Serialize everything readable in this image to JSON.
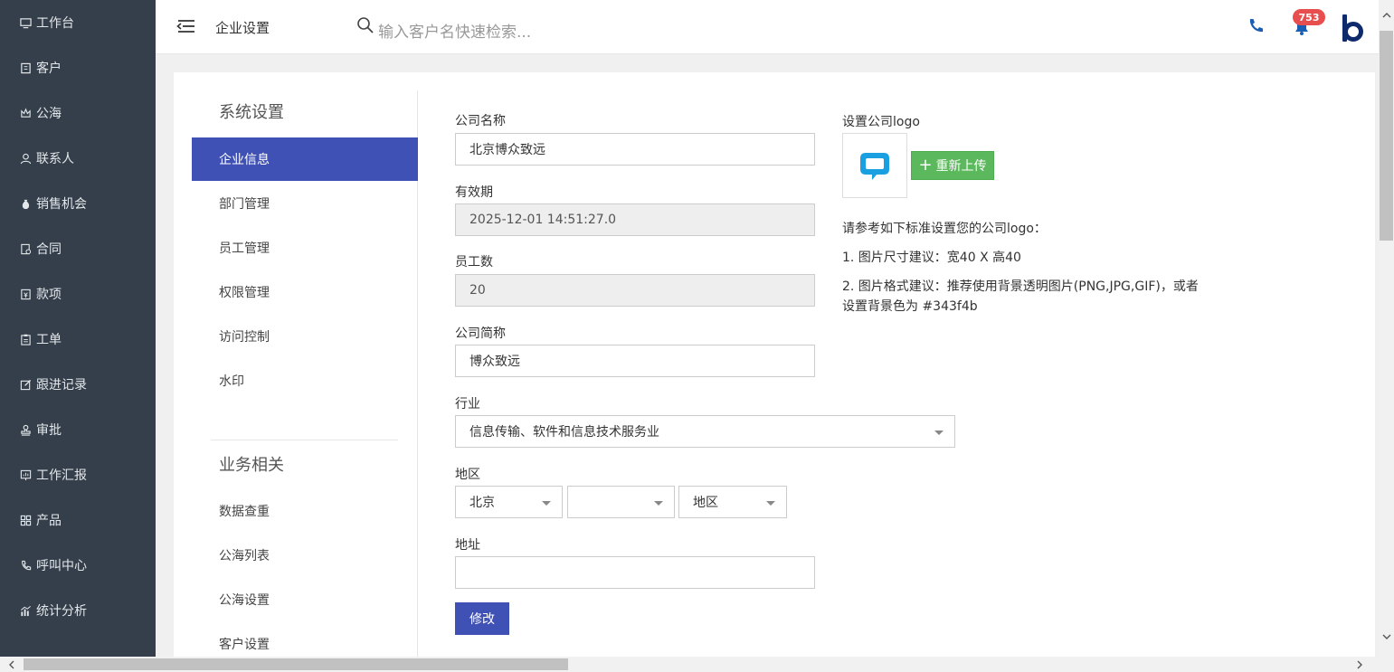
{
  "nav": {
    "items": [
      {
        "label": "工作台",
        "icon": "monitor-icon"
      },
      {
        "label": "客户",
        "icon": "building-icon"
      },
      {
        "label": "公海",
        "icon": "crown-icon"
      },
      {
        "label": "联系人",
        "icon": "user-icon"
      },
      {
        "label": "销售机会",
        "icon": "money-bag-icon"
      },
      {
        "label": "合同",
        "icon": "contract-icon"
      },
      {
        "label": "款项",
        "icon": "payment-icon"
      },
      {
        "label": "工单",
        "icon": "clipboard-icon"
      },
      {
        "label": "跟进记录",
        "icon": "edit-icon"
      },
      {
        "label": "审批",
        "icon": "stamp-icon"
      },
      {
        "label": "工作汇报",
        "icon": "report-icon"
      },
      {
        "label": "产品",
        "icon": "grid-icon"
      },
      {
        "label": "呼叫中心",
        "icon": "phone-call-icon"
      },
      {
        "label": "统计分析",
        "icon": "chart-icon"
      }
    ]
  },
  "header": {
    "title": "企业设置",
    "search_placeholder": "输入客户名快速检索...",
    "notification_count": "753",
    "accent_color": "#1a5fb4"
  },
  "sub_nav": {
    "group1_title": "系统设置",
    "group1_items": [
      "企业信息",
      "部门管理",
      "员工管理",
      "权限管理",
      "访问控制",
      "水印"
    ],
    "active_index": 0,
    "group2_title": "业务相关",
    "group2_items": [
      "数据查重",
      "公海列表",
      "公海设置",
      "客户设置"
    ]
  },
  "form": {
    "company_name_label": "公司名称",
    "company_name_value": "北京博众致远",
    "expiry_label": "有效期",
    "expiry_value": "2025-12-01 14:51:27.0",
    "employees_label": "员工数",
    "employees_value": "20",
    "short_name_label": "公司简称",
    "short_name_value": "博众致远",
    "industry_label": "行业",
    "industry_value": "信息传输、软件和信息技术服务业",
    "region_label": "地区",
    "region_province": "北京",
    "region_city": "",
    "region_district": "地区",
    "address_label": "地址",
    "address_value": "",
    "submit_label": "修改"
  },
  "logo": {
    "label": "设置公司logo",
    "reupload_label": "重新上传",
    "tip_title": "请参考如下标准设置您的公司logo：",
    "tip_1": "1. 图片尺寸建议：宽40 X 高40",
    "tip_2a": "2. 图片格式建议：推荐使用背景透明图片(PNG,JPG,GIF)，或者",
    "tip_2b": "设置背景色为 #343f4b",
    "brand_color": "#1aa0e0"
  },
  "colors": {
    "nav_bg": "#343f4b",
    "primary": "#4051b5",
    "success": "#5cb85c",
    "badge": "#e94e4e"
  }
}
